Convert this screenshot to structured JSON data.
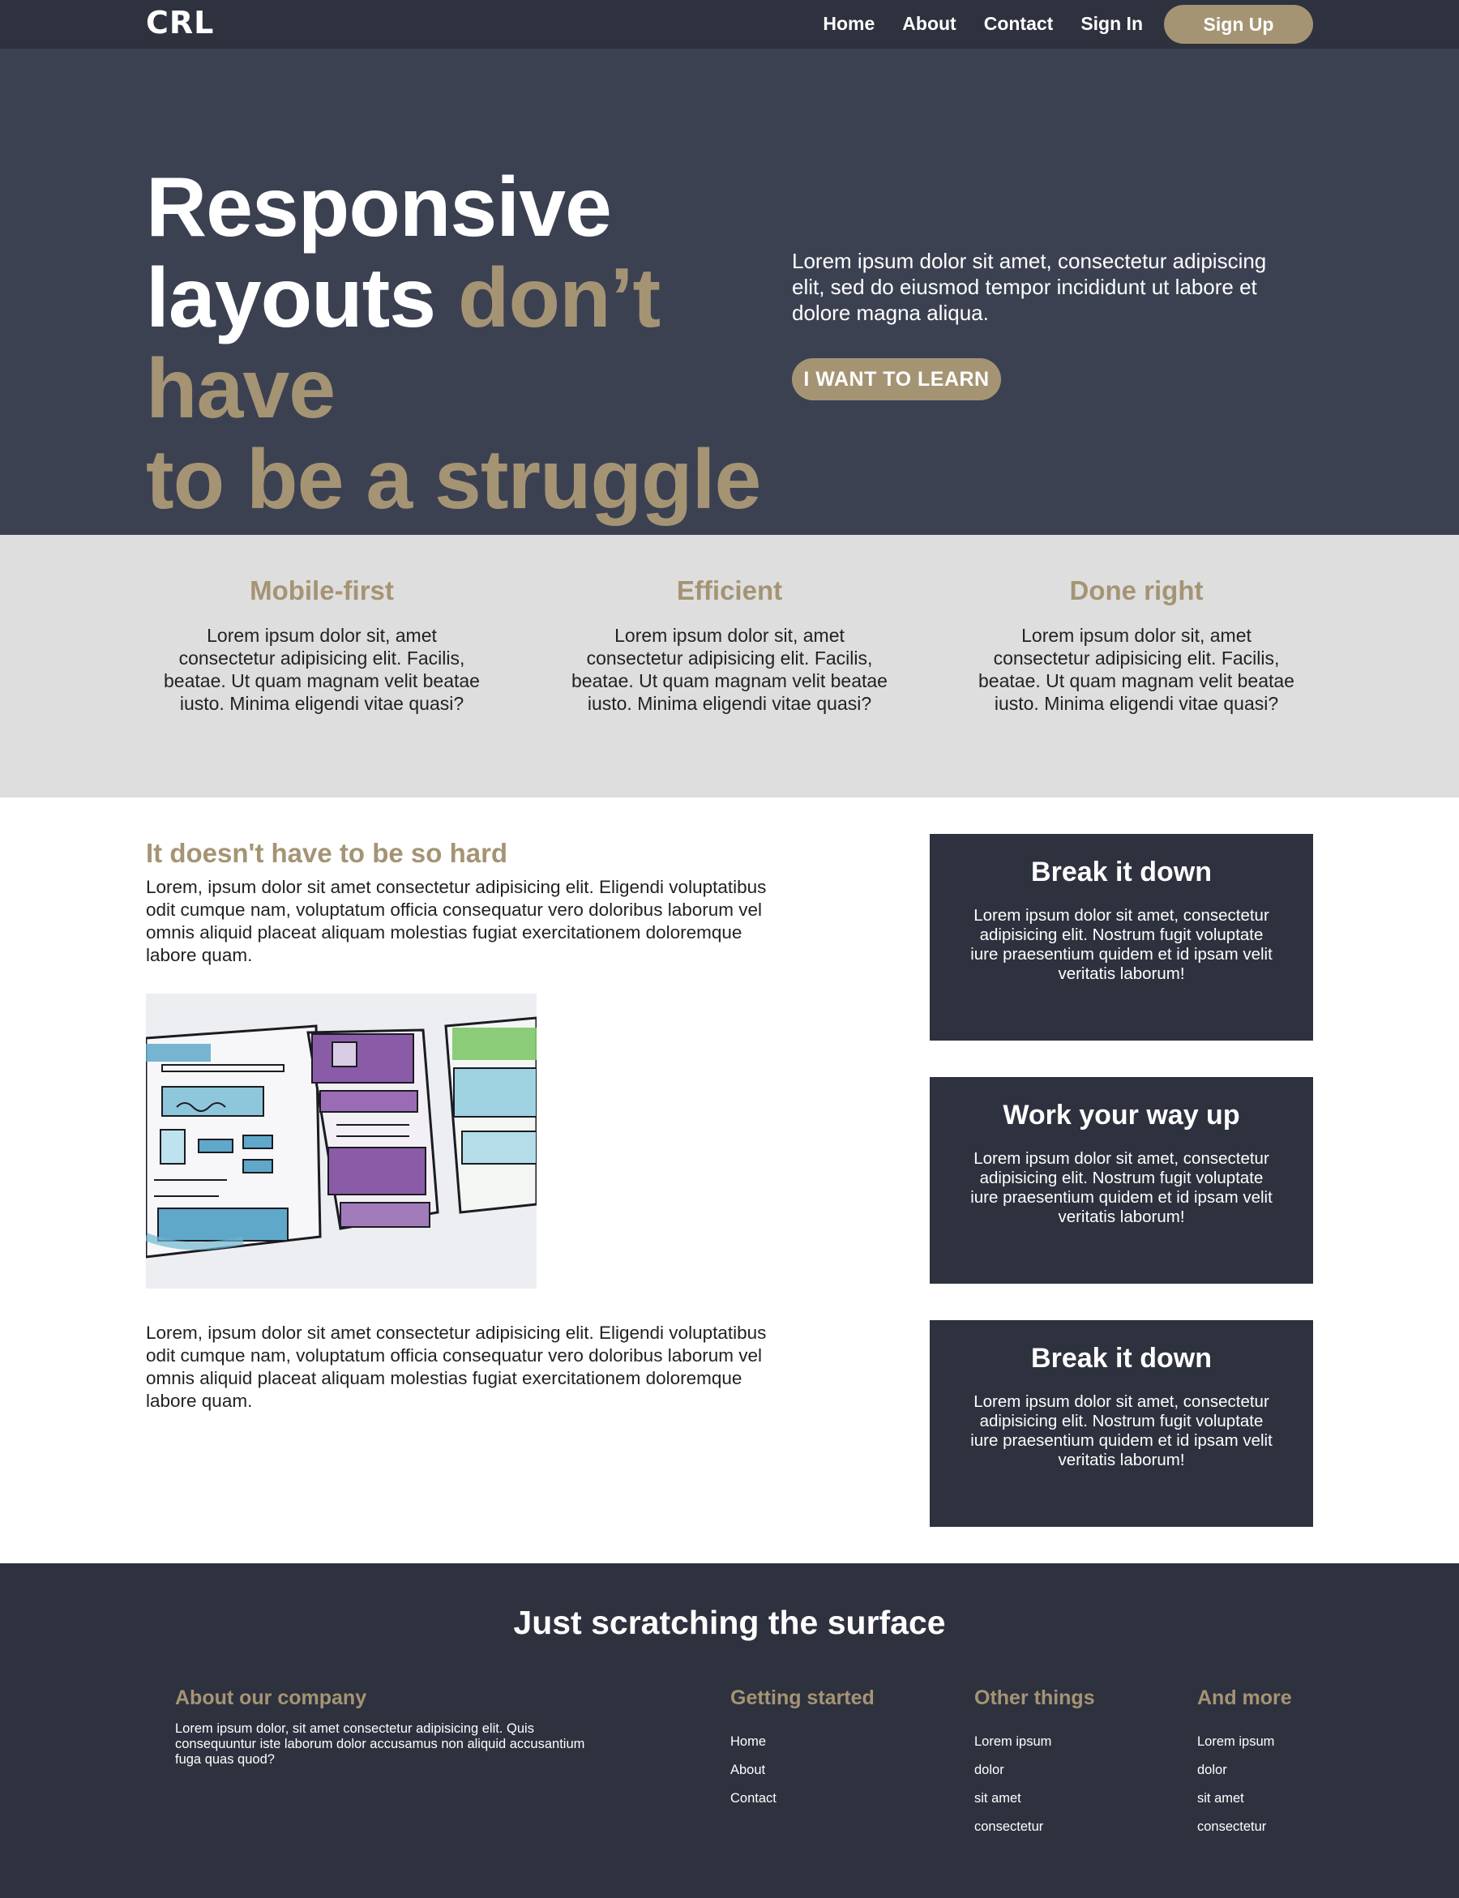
{
  "nav": {
    "logo": "CRL",
    "links": [
      "Home",
      "About",
      "Contact",
      "Sign In"
    ],
    "signup": "Sign Up"
  },
  "hero": {
    "title_line1": "Responsive",
    "title_line2_white": "layouts",
    "title_line2_accent": "don’t have",
    "title_line3_accent": "to be a struggle",
    "text": "Lorem ipsum dolor sit amet, consectetur adipiscing elit, sed do eiusmod tempor incididunt ut labore et dolore magna aliqua.",
    "button": "I WANT TO LEARN"
  },
  "features": [
    {
      "title": "Mobile-first",
      "text": "Lorem ipsum dolor sit, amet consectetur adipisicing elit. Facilis, beatae. Ut quam magnam velit beatae iusto. Minima eligendi vitae quasi?"
    },
    {
      "title": "Efficient",
      "text": "Lorem ipsum dolor sit, amet consectetur adipisicing elit. Facilis, beatae. Ut quam magnam velit beatae iusto. Minima eligendi vitae quasi?"
    },
    {
      "title": "Done right",
      "text": "Lorem ipsum dolor sit, amet consectetur adipisicing elit. Facilis, beatae. Ut quam magnam velit beatae iusto. Minima eligendi vitae quasi?"
    }
  ],
  "article": {
    "title": "It doesn't have to be so hard",
    "para1": "Lorem, ipsum dolor sit amet consectetur adipisicing elit. Eligendi voluptatibus odit cumque nam, voluptatum officia consequatur vero doloribus laborum vel omnis aliquid placeat aliquam molestias fugiat exercitationem doloremque labore quam.",
    "para2": "Lorem, ipsum dolor sit amet consectetur adipisicing elit. Eligendi voluptatibus odit cumque nam, voluptatum officia consequatur vero doloribus laborum vel omnis aliquid placeat aliquam molestias fugiat exercitationem doloremque labore quam."
  },
  "cards": [
    {
      "title": "Break it down",
      "text": "Lorem ipsum dolor sit amet, consectetur adipisicing elit. Nostrum fugit voluptate iure praesentium quidem et id ipsam velit veritatis laborum!"
    },
    {
      "title": "Work your way up",
      "text": "Lorem ipsum dolor sit amet, consectetur adipisicing elit. Nostrum fugit voluptate iure praesentium quidem et id ipsam velit veritatis laborum!"
    },
    {
      "title": "Break it down",
      "text": "Lorem ipsum dolor sit amet, consectetur adipisicing elit. Nostrum fugit voluptate iure praesentium quidem et id ipsam velit veritatis laborum!"
    }
  ],
  "footer": {
    "title": "Just scratching the surface",
    "about": {
      "title": "About our company",
      "text": "Lorem ipsum dolor, sit amet consectetur adipisicing elit. Quis consequuntur iste laborum dolor accusamus non aliquid accusantium fuga quas quod?"
    },
    "columns": [
      {
        "title": "Getting started",
        "items": [
          "Home",
          "About",
          "Contact"
        ]
      },
      {
        "title": "Other things",
        "items": [
          "Lorem ipsum",
          "dolor",
          "sit amet",
          "consectetur"
        ]
      },
      {
        "title": "And more",
        "items": [
          "Lorem ipsum",
          "dolor",
          "sit amet",
          "consectetur"
        ]
      }
    ]
  },
  "colors": {
    "nav_bg": "#2e313e",
    "hero_bg": "#3c4152",
    "accent": "#a59474",
    "features_bg": "#dedede",
    "card_bg": "#2e313e"
  }
}
